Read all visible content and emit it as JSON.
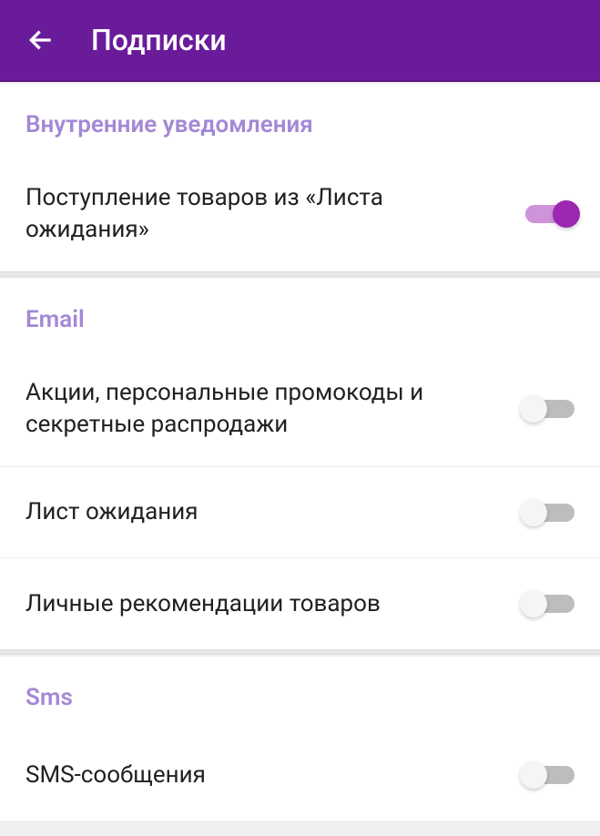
{
  "header": {
    "title": "Подписки"
  },
  "sections": {
    "internal": {
      "title": "Внутренние уведомления",
      "items": [
        {
          "label": "Поступление товаров из «Листа ожидания»",
          "enabled": true
        }
      ]
    },
    "email": {
      "title": "Email",
      "items": [
        {
          "label": "Акции, персональные промокоды и секретные распродажи",
          "enabled": false
        },
        {
          "label": "Лист ожидания",
          "enabled": false
        },
        {
          "label": "Личные рекомендации товаров",
          "enabled": false
        }
      ]
    },
    "sms": {
      "title": "Sms",
      "items": [
        {
          "label": "SMS-сообщения",
          "enabled": false
        }
      ]
    }
  }
}
